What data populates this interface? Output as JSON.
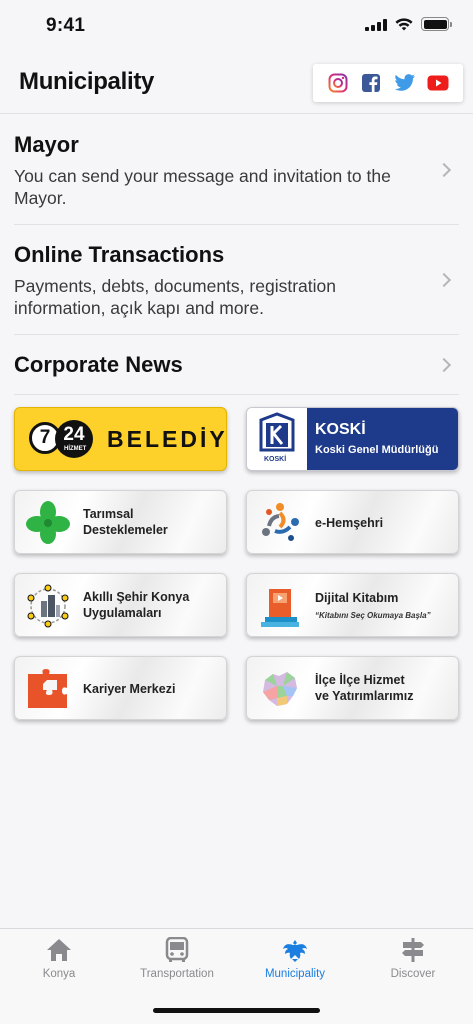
{
  "status": {
    "time": "9:41"
  },
  "header": {
    "title": "Municipality"
  },
  "social": [
    {
      "name": "instagram-icon",
      "color": "#c13584"
    },
    {
      "name": "facebook-icon",
      "color": "#1877f2"
    },
    {
      "name": "twitter-icon",
      "color": "#1da1f2"
    },
    {
      "name": "youtube-icon",
      "color": "#ff0000"
    }
  ],
  "menu": {
    "mayor": {
      "title": "Mayor",
      "description": "You can send your message and invitation to the Mayor."
    },
    "transactions": {
      "title": "Online Transactions",
      "description": "Payments, debts, documents, registration information, açık kapı and more."
    },
    "news": {
      "title": "Corporate News"
    }
  },
  "cards": {
    "belediye": {
      "num1": "7",
      "num2": "24",
      "hizmet": "HİZMET",
      "word": "BELEDİYE"
    },
    "koski": {
      "title": "KOSKİ",
      "subtitle": "Koski Genel Müdürlüğü",
      "logo_text": "KOSKİ"
    },
    "tarimsal": {
      "line1": "Tarımsal",
      "line2": "Desteklemeler"
    },
    "ehemsehri": {
      "label": "e-Hemşehri"
    },
    "akilli": {
      "line1": "Akıllı Şehir Konya",
      "line2": "Uygulamaları"
    },
    "kitabim": {
      "title": "Dijital Kitabım",
      "subtitle": "“Kitabını Seç Okumaya Başla”"
    },
    "kariyer": {
      "label": "Kariyer Merkezi"
    },
    "ilce": {
      "line1": "İlçe İlçe Hizmet",
      "line2": "ve Yatırımlarımız"
    }
  },
  "tabs": [
    {
      "label": "Konya",
      "icon": "home-icon",
      "active": false
    },
    {
      "label": "Transportation",
      "icon": "bus-icon",
      "active": false
    },
    {
      "label": "Municipality",
      "icon": "municipality-eagle-icon",
      "active": true
    },
    {
      "label": "Discover",
      "icon": "signpost-icon",
      "active": false
    }
  ],
  "colors": {
    "accent": "#1a7fe0",
    "inactive": "#8a8a8e",
    "koski_blue": "#1e3a8a",
    "belediye_yellow": "#fdd12a"
  }
}
